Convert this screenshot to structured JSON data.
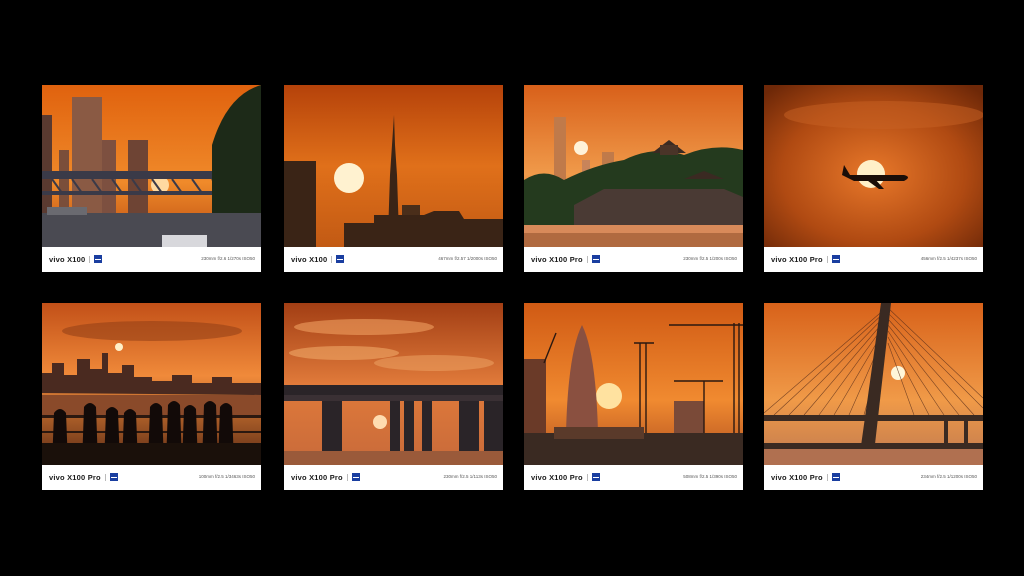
{
  "gallery": {
    "accent_color": "#1a3ea0",
    "cards": [
      {
        "brand": "vivo X100",
        "exif": "230mm  f/2.6  1/270s  ISO50"
      },
      {
        "brand": "vivo X100",
        "exif": "467mm  f/2.57  1/2000s  ISO50"
      },
      {
        "brand": "vivo X100 Pro",
        "exif": "230mm  f/2.5  1/200s  ISO50"
      },
      {
        "brand": "vivo X100 Pro",
        "exif": "456mm  f/2.5  1/4237s  ISO50"
      },
      {
        "brand": "vivo X100 Pro",
        "exif": "100mm  f/2.5  1/3463s  ISO50"
      },
      {
        "brand": "vivo X100 Pro",
        "exif": "230mm  f/2.5  1/113s  ISO50"
      },
      {
        "brand": "vivo X100 Pro",
        "exif": "508mm  f/2.5  1/390s  ISO50"
      },
      {
        "brand": "vivo X100 Pro",
        "exif": "234mm  f/2.5  1/1200s  ISO50"
      }
    ]
  }
}
